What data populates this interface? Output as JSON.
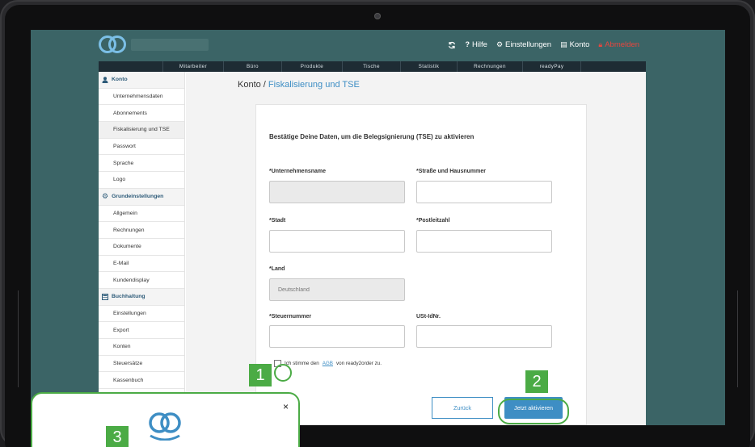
{
  "header": {
    "refresh_icon": "refresh-icon",
    "help": {
      "icon": "?",
      "label": "Hilfe"
    },
    "settings": {
      "icon": "gear-icon",
      "label": "Einstellungen"
    },
    "account": {
      "icon": "document-icon",
      "label": "Konto"
    },
    "logout": {
      "icon": "lock-icon",
      "label": "Abmelden"
    },
    "logout_color": "#e8463f"
  },
  "nav": [
    "Mitarbeiter",
    "Büro",
    "Produkte",
    "Tische",
    "Statistik",
    "Rechnungen",
    "readyPay"
  ],
  "sidebar": {
    "sections": [
      {
        "title": "Konto",
        "icon": "user-icon",
        "items": [
          "Unternehmensdaten",
          "Abonnements",
          "Fiskalisierung und TSE",
          "Passwort",
          "Sprache",
          "Logo"
        ]
      },
      {
        "title": "Grundeinstellungen",
        "icon": "gears-icon",
        "items": [
          "Allgemein",
          "Rechnungen",
          "Dokumente",
          "E-Mail",
          "Kundendisplay"
        ]
      },
      {
        "title": "Buchhaltung",
        "icon": "calculator-icon",
        "items": [
          "Einstellungen",
          "Export",
          "Konten",
          "Steuersätze",
          "Kassenbuch"
        ]
      }
    ],
    "active_item": "Fiskalisierung und TSE"
  },
  "page": {
    "breadcrumb_root": "Konto /",
    "breadcrumb_current": "Fiskalisierung und TSE"
  },
  "form": {
    "heading": "Bestätige Deine Daten, um die Belegsignierung (TSE) zu aktivieren",
    "company_label": "*Unternehmensname",
    "company_value": "",
    "street_label": "*Straße und Hausnummer",
    "street_value": "",
    "city_label": "*Stadt",
    "city_value": "",
    "zip_label": "*Postleitzahl",
    "zip_value": "",
    "country_label": "*Land",
    "country_value": "Deutschland",
    "tax_label": "*Steuernummer",
    "tax_value": "",
    "vat_label": "USt-IdNr.",
    "vat_value": "",
    "agree_pre": "Ich stimme den",
    "agree_link": "AGB",
    "agree_post": "von ready2order zu.",
    "back_label": "Zurück",
    "submit_label": "Jetzt aktivieren"
  },
  "tutorial": {
    "step1": "1",
    "step2": "2",
    "step3": "3",
    "highlight_color": "#4bab45",
    "popup_close": "×"
  },
  "colors": {
    "accent": "#3e8ec4",
    "header_bg": "#3b6466",
    "nav_bg": "#1e2c34"
  }
}
